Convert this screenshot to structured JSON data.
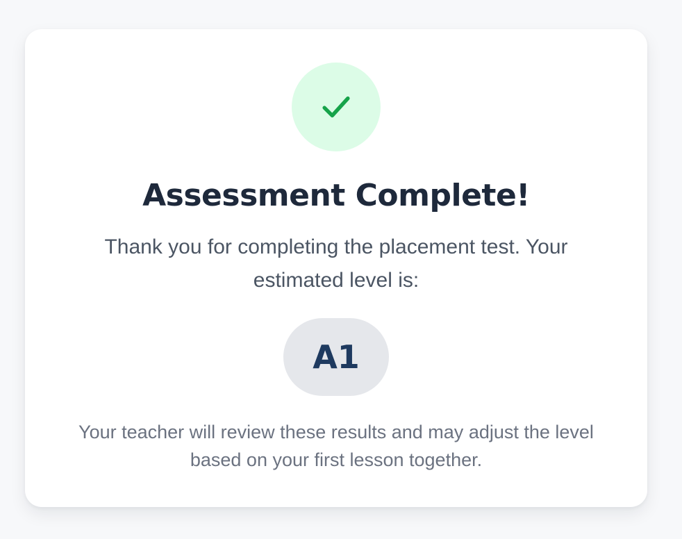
{
  "result": {
    "title": "Assessment Complete!",
    "message": "Thank you for completing the placement test. Your estimated level is:",
    "level": "A1",
    "note": "Your teacher will review these results and may adjust the level based on your first lesson together.",
    "icon": "check-icon"
  },
  "colors": {
    "success_green": "#16a34a",
    "success_bg": "#dcfce7",
    "title": "#1e293b",
    "badge_bg": "#e5e7eb",
    "badge_text": "#1e3a5f"
  }
}
